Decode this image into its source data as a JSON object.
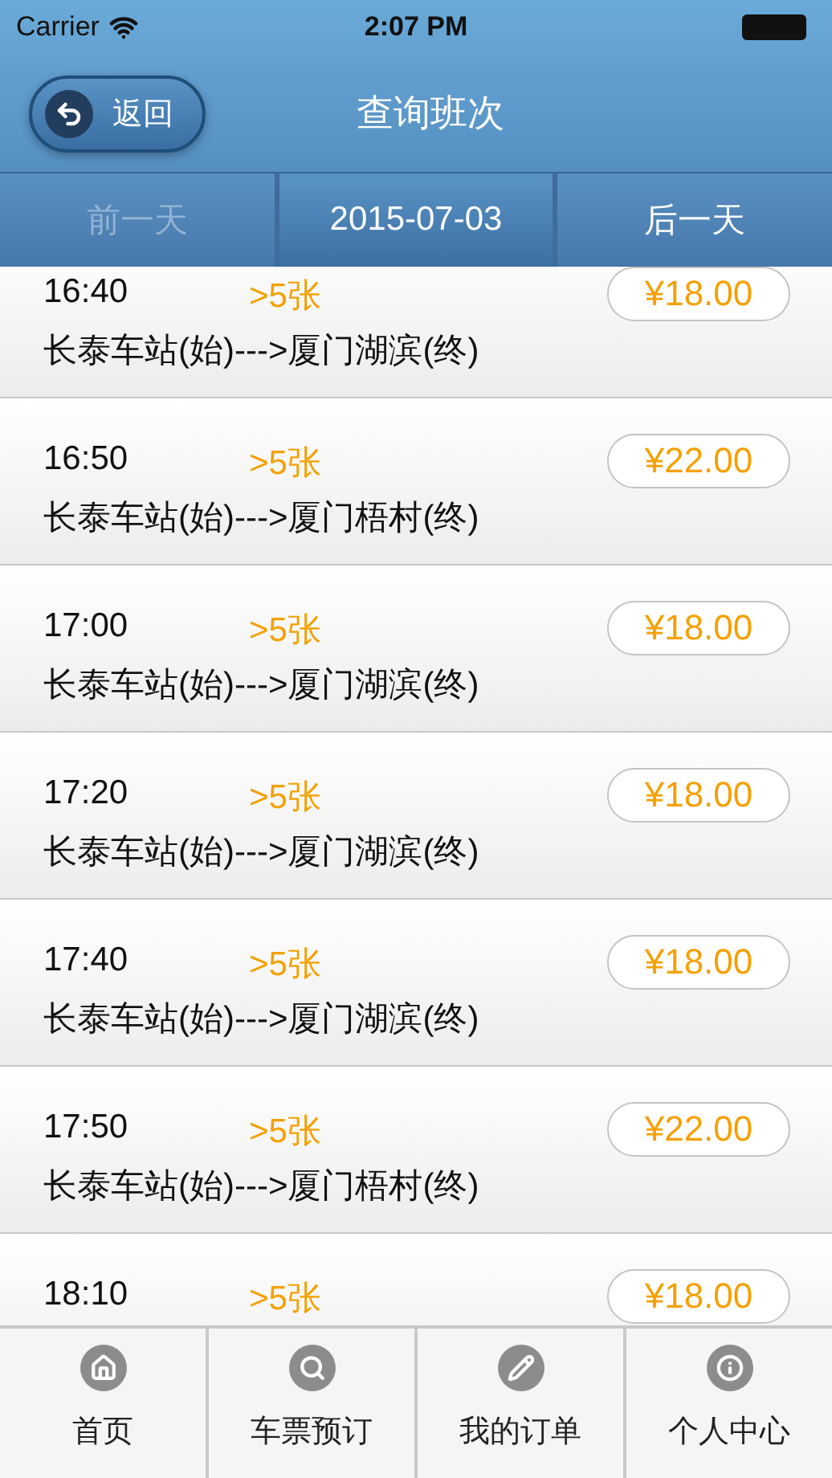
{
  "status_bar": {
    "carrier": "Carrier",
    "time": "2:07 PM"
  },
  "nav": {
    "back": "返回",
    "title": "查询班次"
  },
  "date_bar": {
    "prev": {
      "label": "前一天",
      "disabled": true
    },
    "date": "2015-07-03",
    "next": {
      "label": "后一天",
      "disabled": false
    }
  },
  "trips": [
    {
      "time": "16:40",
      "seats": ">5张",
      "route": "长泰车站(始)--->厦门湖滨(终)",
      "price": "¥18.00"
    },
    {
      "time": "16:50",
      "seats": ">5张",
      "route": "长泰车站(始)--->厦门梧村(终)",
      "price": "¥22.00"
    },
    {
      "time": "17:00",
      "seats": ">5张",
      "route": "长泰车站(始)--->厦门湖滨(终)",
      "price": "¥18.00"
    },
    {
      "time": "17:20",
      "seats": ">5张",
      "route": "长泰车站(始)--->厦门湖滨(终)",
      "price": "¥18.00"
    },
    {
      "time": "17:40",
      "seats": ">5张",
      "route": "长泰车站(始)--->厦门湖滨(终)",
      "price": "¥18.00"
    },
    {
      "time": "17:50",
      "seats": ">5张",
      "route": "长泰车站(始)--->厦门梧村(终)",
      "price": "¥22.00"
    },
    {
      "time": "18:10",
      "seats": ">5张",
      "price": "¥18.00"
    }
  ],
  "tab_bar": [
    {
      "kind": "home",
      "label": "首页"
    },
    {
      "kind": "search",
      "label": "车票预订"
    },
    {
      "kind": "edit",
      "label": "我的订单"
    },
    {
      "kind": "info",
      "label": "个人中心"
    }
  ]
}
